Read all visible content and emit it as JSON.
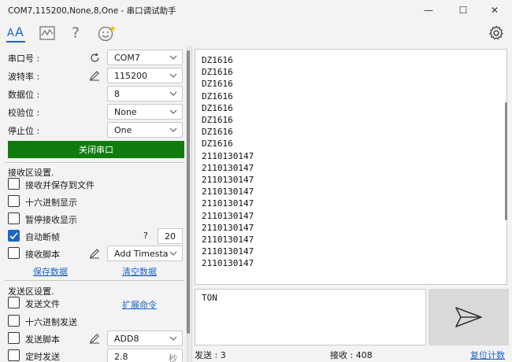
{
  "window": {
    "title": "COM7,115200,None,8,One - 串口调试助手",
    "minimize": "—",
    "maximize": "☐",
    "close": "✕"
  },
  "toolbar": {
    "font_icon_text": "AA",
    "help_text": "?"
  },
  "serial": {
    "port_label": "串口号 :",
    "port_value": "COM7",
    "baud_label": "波特率 :",
    "baud_value": "115200",
    "databits_label": "数据位 :",
    "databits_value": "8",
    "parity_label": "校验位 :",
    "parity_value": "None",
    "stopbits_label": "停止位 :",
    "stopbits_value": "One",
    "toggle_button": "关闭串口"
  },
  "receive_settings": {
    "section_title": "接收区设置.",
    "save_to_file": "接收并保存到文件",
    "hex_display": "十六进制显示",
    "pause_display": "暂停接收显示",
    "auto_frame": "自动断帧",
    "auto_frame_checked": true,
    "auto_frame_help": "?",
    "auto_frame_value": "20",
    "script_label": "接收脚本",
    "script_value": "Add Timesta",
    "save_data": "保存数据",
    "clear_data": "清空数据"
  },
  "send_settings": {
    "section_title": "发送区设置.",
    "send_file": "发送文件",
    "extend_cmd": "扩展命令",
    "hex_send": "十六进制发送",
    "script_label": "发送脚本",
    "script_value": "ADD8",
    "timed_send": "定时发送",
    "timed_value": "2.8",
    "timed_unit": "秒"
  },
  "receive_lines": [
    "DZ1616",
    "DZ1616",
    "DZ1616",
    "DZ1616",
    "DZ1616",
    "DZ1616",
    "DZ1616",
    "DZ1616",
    "2110130147",
    "2110130147",
    "2110130147",
    "2110130147",
    "2110130147",
    "2110130147",
    "2110130147",
    "2110130147",
    "2110130147",
    "2110130147"
  ],
  "send_text": "TON",
  "status": {
    "sent": "发送 : 3",
    "received": "接收 : 408",
    "reset": "复位计数"
  },
  "colors": {
    "accent": "#1e64c8",
    "toggle_button_bg": "#107c10"
  }
}
